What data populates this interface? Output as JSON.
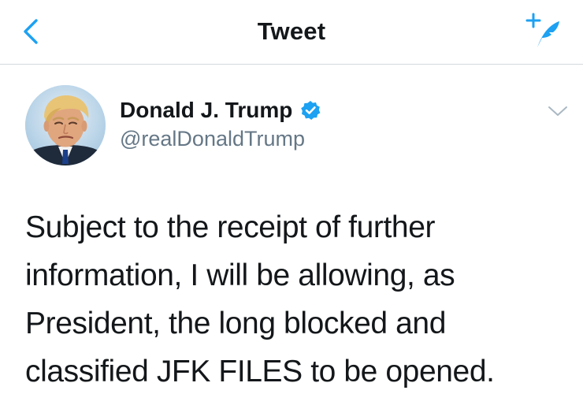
{
  "header": {
    "title": "Tweet",
    "back_icon": "chevron-left-icon",
    "compose_icon": "compose-tweet-icon",
    "accent_color": "#1da1f2"
  },
  "tweet": {
    "author": {
      "name": "Donald J. Trump",
      "handle": "@realDonaldTrump",
      "verified": true,
      "verified_icon": "verified-badge-icon"
    },
    "menu_icon": "chevron-down-icon",
    "text_lines": [
      "Subject to the receipt of further",
      "information, I will be allowing, as",
      "President, the long blocked and",
      "classified JFK FILES to be opened."
    ]
  }
}
